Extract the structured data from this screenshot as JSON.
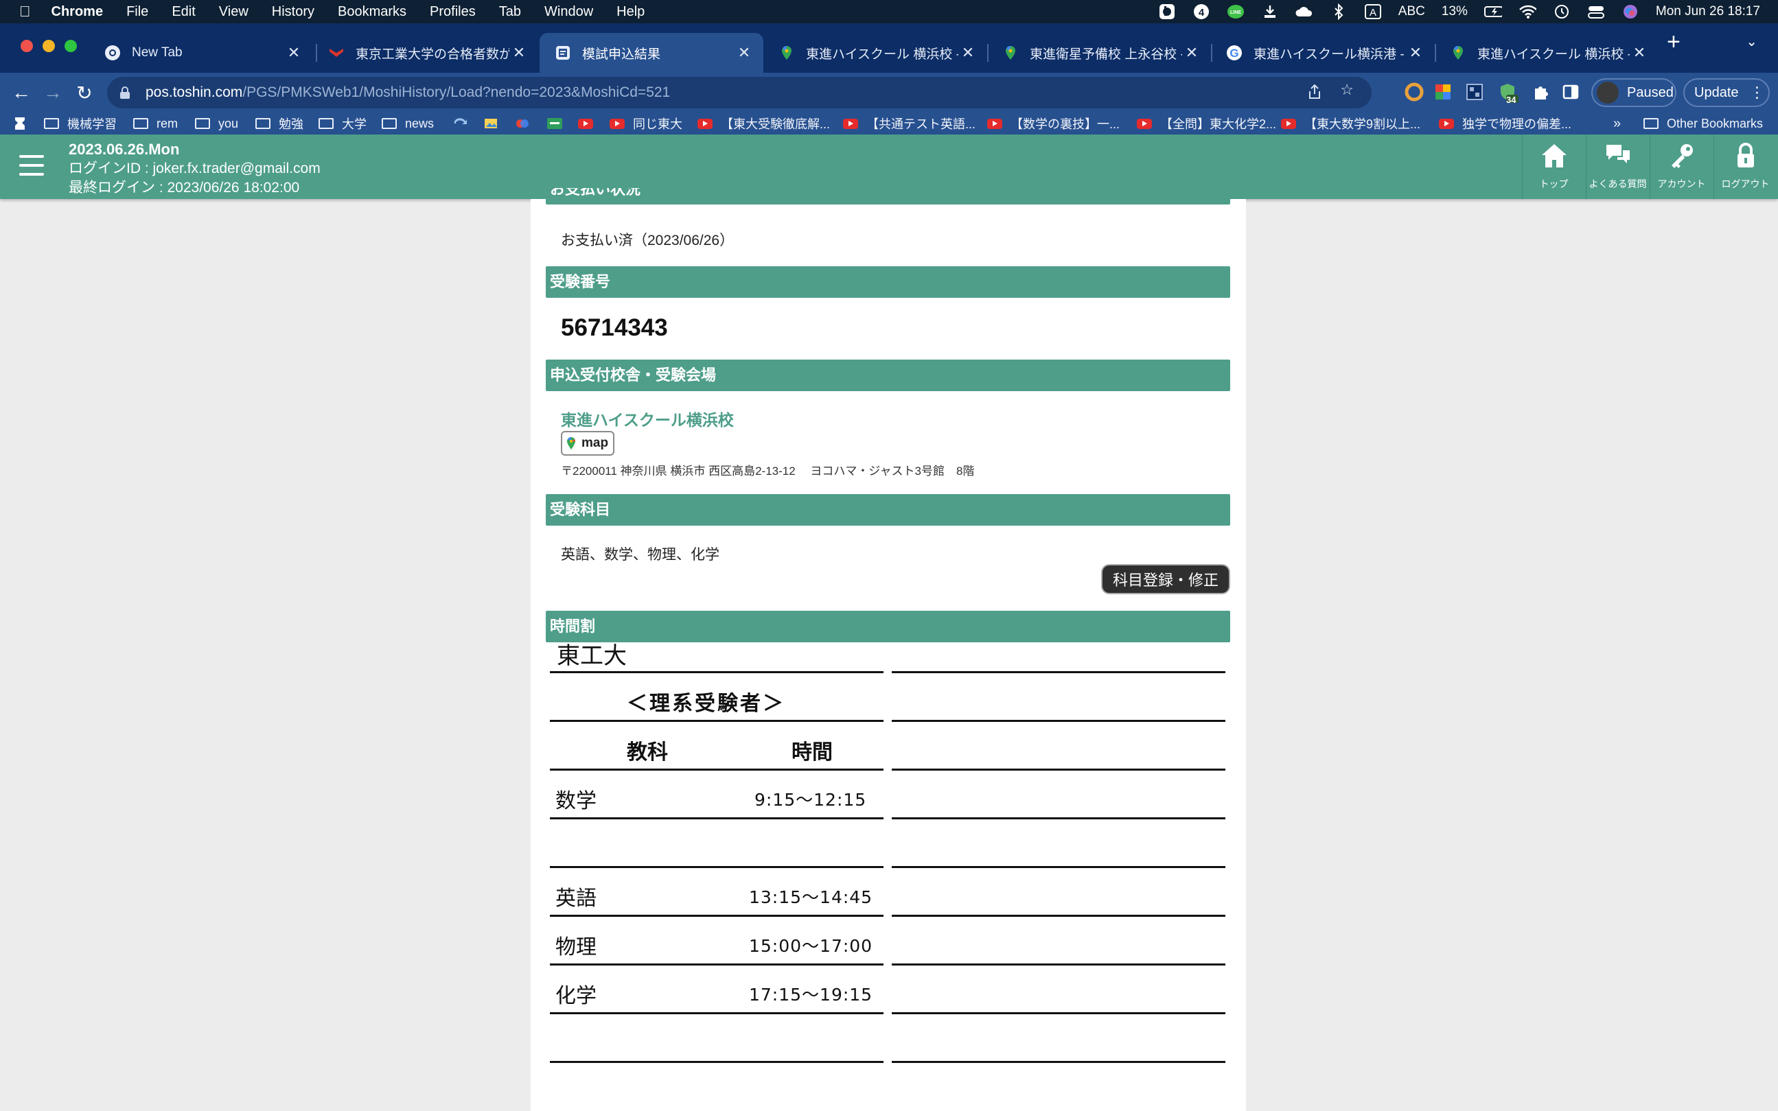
{
  "macos": {
    "app_name": "Chrome",
    "menus": [
      "File",
      "Edit",
      "View",
      "History",
      "Bookmarks",
      "Profiles",
      "Tab",
      "Window",
      "Help"
    ],
    "input_mode": "ABC",
    "battery": "13%",
    "datetime": "Mon Jun 26  18:17"
  },
  "tabs": [
    {
      "title": "New Tab",
      "icon": "chrome-icon",
      "active": false
    },
    {
      "title": "東京工業大学の合格者数が多",
      "icon": "school-icon",
      "active": false
    },
    {
      "title": "模試申込結果",
      "icon": "page-icon",
      "active": true
    },
    {
      "title": "東進ハイスクール 横浜校 - Go",
      "icon": "maps-icon",
      "active": false
    },
    {
      "title": "東進衛星予備校 上永谷校 - Go",
      "icon": "maps-icon",
      "active": false
    },
    {
      "title": "東進ハイスクール横浜港 - Go",
      "icon": "google-icon",
      "active": false
    },
    {
      "title": "東進ハイスクール 横浜校 - Go",
      "icon": "maps-icon",
      "active": false
    }
  ],
  "address_bar": {
    "host": "pos.toshin.com",
    "path": "/PGS/PMKSWeb1/MoshiHistory/Load?nendo=2023&MoshiCd=521"
  },
  "profile": {
    "status": "Paused"
  },
  "update_label": "Update",
  "extensions": {
    "badge_count": "34"
  },
  "bookmarks": [
    {
      "label": "機械学習",
      "type": "folder"
    },
    {
      "label": "rem",
      "type": "folder"
    },
    {
      "label": "you",
      "type": "folder"
    },
    {
      "label": "勉強",
      "type": "folder"
    },
    {
      "label": "大学",
      "type": "folder"
    },
    {
      "label": "news",
      "type": "folder"
    },
    {
      "label": "同じ東大",
      "type": "youtube"
    },
    {
      "label": "【東大受験徹底解...",
      "type": "youtube"
    },
    {
      "label": "【共通テスト英語...",
      "type": "youtube"
    },
    {
      "label": "【数学の裏技】一...",
      "type": "youtube"
    },
    {
      "label": "【全問】東大化学2...",
      "type": "youtube"
    },
    {
      "label": "【東大数学9割以上...",
      "type": "youtube"
    },
    {
      "label": "独学で物理の偏差...",
      "type": "youtube"
    }
  ],
  "bookmarks_more": "»",
  "other_bookmarks": "Other Bookmarks",
  "site_header": {
    "date": "2023.06.26.Mon",
    "login_id": "ログインID : joker.fx.trader@gmail.com",
    "last_login": "最終ログイン : 2023/06/26 18:02:00",
    "nav": [
      "トップ",
      "よくある質問",
      "アカウント",
      "ログアウト"
    ]
  },
  "content": {
    "payment_header": "お支払い状況",
    "payment_status": "お支払い済（2023/06/26）",
    "exam_number_header": "受験番号",
    "exam_number": "56714343",
    "venue_header": "申込受付校舎・受験会場",
    "venue_name": "東進ハイスクール横浜校",
    "map_label": "map",
    "venue_address": "〒2200011 神奈川県 横浜市 西区高島2-13-12　 ヨコハマ・ジャスト3号館　8階",
    "subjects_header": "受験科目",
    "subjects": "英語、数学、物理、化学",
    "edit_button": "科目登録・修正",
    "timetable_header": "時間割"
  },
  "timetable": {
    "university": "東工大",
    "category": "＜理系受験者＞",
    "col_subject": "教科",
    "col_time": "時間",
    "rows": [
      {
        "subject": "数学",
        "time": "9:15〜12:15"
      },
      {
        "subject": "英語",
        "time": "13:15〜14:45"
      },
      {
        "subject": "物理",
        "time": "15:00〜17:00"
      },
      {
        "subject": "化学",
        "time": "17:15〜19:15"
      }
    ]
  },
  "colors": {
    "site_green": "#4e9e8a",
    "chrome_blue": "#27508f",
    "tab_strip": "#0c2d66"
  }
}
